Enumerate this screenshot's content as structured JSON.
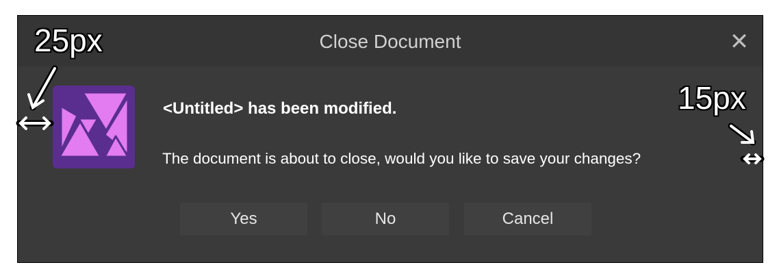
{
  "dialog": {
    "title": "Close Document",
    "close_symbol": "✕",
    "heading_tag": "<Untitled>",
    "heading_rest": " has been modified.",
    "message": "The document is about to close, would you like to save your changes?",
    "buttons": {
      "yes": "Yes",
      "no": "No",
      "cancel": "Cancel"
    },
    "app_icon": "affinity-photo-icon",
    "colors": {
      "dialog_bg": "#3a3a3a",
      "titlebar_bg": "#353535",
      "button_bg": "#404040",
      "icon_purple": "#5a2e8e",
      "icon_pink": "#e27cf0"
    }
  },
  "annotations": {
    "left_margin_label": "25px",
    "right_margin_label": "15px"
  }
}
